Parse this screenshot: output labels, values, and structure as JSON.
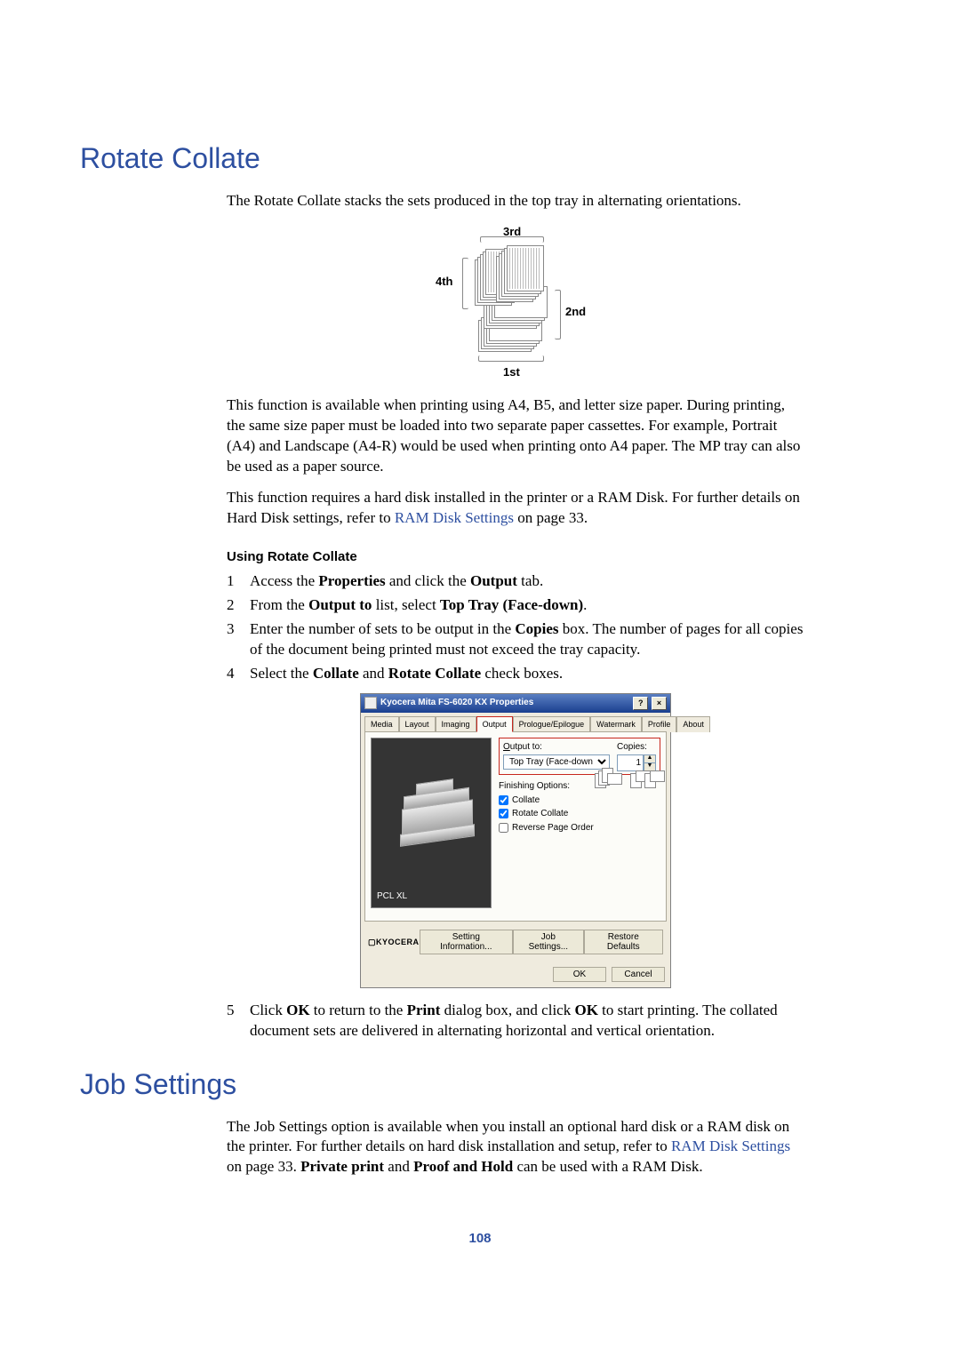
{
  "sections": {
    "rotate_collate": {
      "heading": "Rotate Collate",
      "intro": "The Rotate Collate stacks the sets produced in the top tray in alternating orientations.",
      "diagram_labels": {
        "first": "1st",
        "second": "2nd",
        "third": "3rd",
        "fourth": "4th"
      },
      "p1_full": "This function is available when printing using A4, B5, and letter size paper. During printing, the same size paper must be loaded into two separate paper cassettes. For example, Portrait (A4) and Landscape (A4-R) would be used when printing onto A4 paper. The MP tray can also be used as a paper source.",
      "p2_a": "This function requires a hard disk installed in the printer or a RAM Disk. For further details on Hard Disk settings, refer to ",
      "p2_link": "RAM Disk Settings",
      "p2_b": " on page 33.",
      "using_heading": "Using Rotate Collate",
      "steps": {
        "s1_a": "Access the ",
        "s1_b": "Properties",
        "s1_c": " and click the ",
        "s1_d": "Output",
        "s1_e": " tab.",
        "s2_a": "From the ",
        "s2_b": "Output to",
        "s2_c": " list, select ",
        "s2_d": "Top Tray (Face-down)",
        "s2_e": ".",
        "s3_a": "Enter the number of sets to be output in the ",
        "s3_b": "Copies",
        "s3_c": " box. The number of pages for all copies of the document being printed must not exceed the tray capacity.",
        "s4_a": "Select the ",
        "s4_b": "Collate",
        "s4_c": " and ",
        "s4_d": "Rotate Collate",
        "s4_e": " check boxes.",
        "s5_a": "Click ",
        "s5_b": "OK",
        "s5_c": " to return to the ",
        "s5_d": "Print",
        "s5_e": " dialog box, and click ",
        "s5_f": "OK",
        "s5_g": " to start printing. The collated document sets are delivered in alternating horizontal and vertical orientation."
      }
    },
    "job_settings": {
      "heading": "Job Settings",
      "p1_a": "The Job Settings option is available when you install an optional hard disk or a RAM disk on the printer. For further details on hard disk installation and setup, refer to ",
      "p1_link": "RAM Disk Settings",
      "p1_b": " on page 33. ",
      "p1_c": "Private print",
      "p1_d": " and ",
      "p1_e": "Proof and Hold",
      "p1_f": " can be used with a RAM Disk."
    }
  },
  "dialog": {
    "title": "Kyocera Mita FS-6020 KX Properties",
    "tabs": [
      "Media",
      "Layout",
      "Imaging",
      "Output",
      "Prologue/Epilogue",
      "Watermark",
      "Profile",
      "About"
    ],
    "active_tab_index": 3,
    "preview_label": "PCL XL",
    "output_to_label": "Output to:",
    "output_to_value": "Top Tray (Face-down)",
    "copies_label": "Copies:",
    "copies_value": "1",
    "finishing_label": "Finishing Options:",
    "cb_collate": "Collate",
    "cb_rotate": "Rotate Collate",
    "cb_reverse": "Reverse Page Order",
    "brand": "KYOCERA",
    "btn_setting_info": "Setting Information...",
    "btn_job_settings": "Job Settings...",
    "btn_restore": "Restore Defaults",
    "btn_ok": "OK",
    "btn_cancel": "Cancel"
  },
  "page_number": "108"
}
